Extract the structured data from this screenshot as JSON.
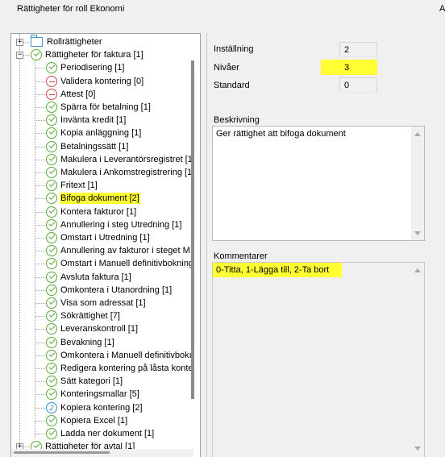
{
  "window": {
    "title": "Rättigheter för roll Ekonomi",
    "title_right": "A"
  },
  "tree": {
    "nodes": [
      {
        "label": "Rollrättigheter",
        "icon": "folder-icon",
        "level": 0,
        "expander": "+"
      },
      {
        "label": "Rättigheter för faktura [1]",
        "icon": "check-circle-icon",
        "level": 0,
        "expander": "-"
      },
      {
        "label": "Periodisering [1]",
        "icon": "check-circle-icon",
        "level": 1
      },
      {
        "label": "Validera kontering [0]",
        "icon": "minus-circle-icon",
        "level": 1
      },
      {
        "label": "Attest [0]",
        "icon": "minus-circle-icon",
        "level": 1
      },
      {
        "label": "Spärra för betalning [1]",
        "icon": "check-circle-icon",
        "level": 1
      },
      {
        "label": "Invänta kredit [1]",
        "icon": "check-circle-icon",
        "level": 1
      },
      {
        "label": "Kopia anläggning [1]",
        "icon": "check-circle-icon",
        "level": 1
      },
      {
        "label": "Betalningssätt [1]",
        "icon": "check-circle-icon",
        "level": 1
      },
      {
        "label": "Makulera i Leverantörsregistret [1",
        "icon": "check-circle-icon",
        "level": 1
      },
      {
        "label": "Makulera i Ankomstregistrering [1",
        "icon": "check-circle-icon",
        "level": 1
      },
      {
        "label": "Fritext [1]",
        "icon": "check-circle-icon",
        "level": 1
      },
      {
        "label": "Bifoga dokument [2]",
        "icon": "check-circle-icon",
        "level": 1,
        "highlight": true
      },
      {
        "label": "Kontera fakturor [1]",
        "icon": "check-circle-icon",
        "level": 1
      },
      {
        "label": "Annullering i steg Utredning [1]",
        "icon": "check-circle-icon",
        "level": 1
      },
      {
        "label": "Omstart i Utredning [1]",
        "icon": "check-circle-icon",
        "level": 1
      },
      {
        "label": "Annullering av fakturor i steget M",
        "icon": "check-circle-icon",
        "level": 1
      },
      {
        "label": "Omstart i Manuell definitivbokning",
        "icon": "check-circle-icon",
        "level": 1
      },
      {
        "label": "Avsluta faktura [1]",
        "icon": "check-circle-icon",
        "level": 1
      },
      {
        "label": "Omkontera i Utanordning [1]",
        "icon": "check-circle-icon",
        "level": 1
      },
      {
        "label": "Visa som adressat [1]",
        "icon": "check-circle-icon",
        "level": 1
      },
      {
        "label": "Sökrättighet [7]",
        "icon": "check-circle-icon",
        "level": 1
      },
      {
        "label": "Leveranskontroll [1]",
        "icon": "check-circle-icon",
        "level": 1
      },
      {
        "label": "Bevakning [1]",
        "icon": "check-circle-icon",
        "level": 1
      },
      {
        "label": "Omkontera i Manuell definitivbokı",
        "icon": "check-circle-icon",
        "level": 1
      },
      {
        "label": "Redigera kontering på låsta konte",
        "icon": "check-circle-icon",
        "level": 1
      },
      {
        "label": "Sätt kategori [1]",
        "icon": "check-circle-icon",
        "level": 1
      },
      {
        "label": "Konteringsmallar [5]",
        "icon": "check-circle-icon",
        "level": 1
      },
      {
        "label": "Kopiera kontering [2]",
        "icon": "two-circle-icon",
        "level": 1
      },
      {
        "label": "Kopiera Excel [1]",
        "icon": "check-circle-icon",
        "level": 1
      },
      {
        "label": "Ladda ner dokument [1]",
        "icon": "check-circle-icon",
        "level": 1
      },
      {
        "label": "Rättigheter för avtal [1]",
        "icon": "check-circle-icon",
        "level": 0,
        "expander": "+"
      }
    ]
  },
  "fields": {
    "installning": {
      "label": "Inställning",
      "value": "2"
    },
    "nivaer": {
      "label": "Nivåer",
      "value": "3"
    },
    "standard": {
      "label": "Standard",
      "value": "0"
    }
  },
  "description": {
    "label": "Beskrivning",
    "text": "Ger rättighet att bifoga dokument"
  },
  "comments": {
    "label": "Kommentarer",
    "text": "0-Titta, 1-Lägga till, 2-Ta bort"
  },
  "colors": {
    "highlight": "#ffff33",
    "ok": "#5aa93a",
    "denied": "#d04848",
    "info": "#3d8fd6"
  }
}
